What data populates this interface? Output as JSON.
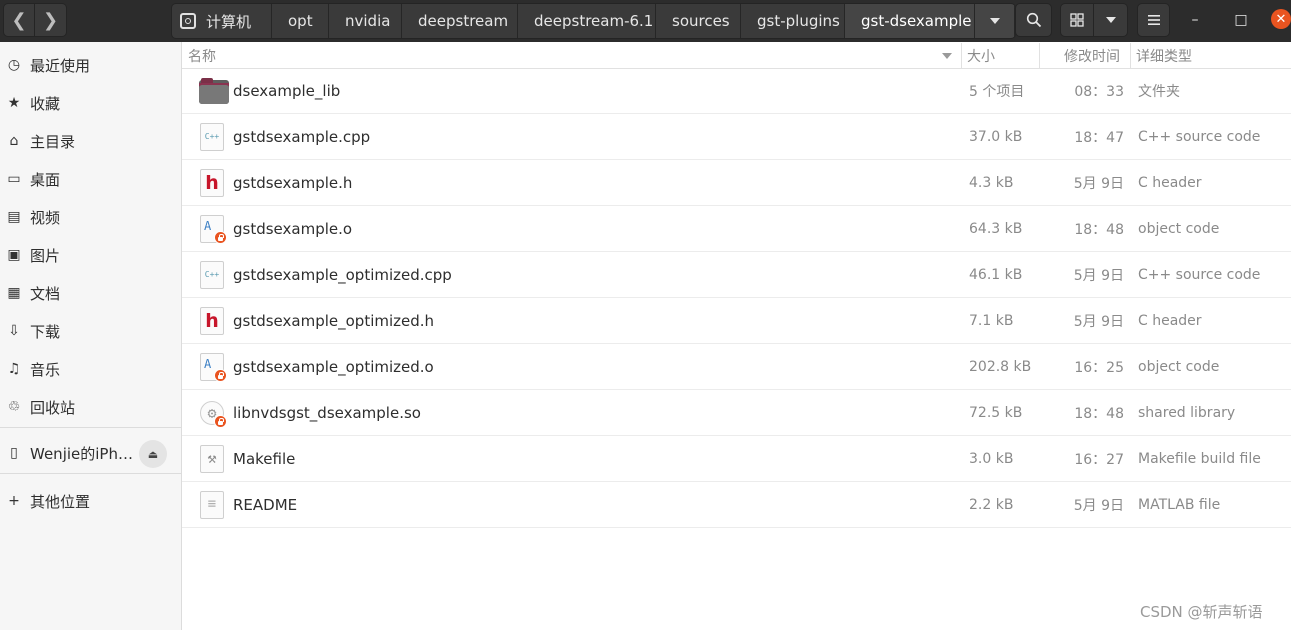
{
  "header": {
    "back_glyph": "❮",
    "forward_glyph": "❯",
    "breadcrumbs": [
      "计算机",
      "opt",
      "nvidia",
      "deepstream",
      "deepstream-6.1",
      "sources",
      "gst-plugins",
      "gst-dsexample"
    ],
    "window_controls": {
      "minimize": "–",
      "maximize": "□",
      "close": "✕"
    }
  },
  "sidebar": {
    "items": [
      {
        "label": "最近使用",
        "icon": "clock-icon",
        "glyph": "◷"
      },
      {
        "label": "收藏",
        "icon": "star-icon",
        "glyph": "★"
      },
      {
        "label": "主目录",
        "icon": "home-icon",
        "glyph": "⌂"
      },
      {
        "label": "桌面",
        "icon": "desktop-icon",
        "glyph": "▭"
      },
      {
        "label": "视频",
        "icon": "video-icon",
        "glyph": "▤"
      },
      {
        "label": "图片",
        "icon": "image-icon",
        "glyph": "▣"
      },
      {
        "label": "文档",
        "icon": "document-icon",
        "glyph": "▦"
      },
      {
        "label": "下载",
        "icon": "download-icon",
        "glyph": "⇩"
      },
      {
        "label": "音乐",
        "icon": "music-icon",
        "glyph": "♫"
      },
      {
        "label": "回收站",
        "icon": "trash-icon",
        "glyph": "♲"
      }
    ],
    "device": {
      "label": "Wenjie的iPh…",
      "icon": "phone-icon",
      "glyph": "▯",
      "eject_glyph": "⏏"
    },
    "other_locations": {
      "label": "其他位置",
      "glyph": "+"
    }
  },
  "columns": {
    "name": "名称",
    "size": "大小",
    "modified": "修改时间",
    "type": "详细类型"
  },
  "files": [
    {
      "name": "dsexample_lib",
      "size": "5 个项目",
      "modified": "08：33",
      "type": "文件夹",
      "icon": "folder-icon"
    },
    {
      "name": "gstdsexample.cpp",
      "size": "37.0 kB",
      "modified": "18：47",
      "type": "C++ source code",
      "icon": "cpp-file-icon",
      "badge": "C++"
    },
    {
      "name": "gstdsexample.h",
      "size": "4.3 kB",
      "modified": "5月 9日",
      "type": "C header",
      "icon": "header-file-icon",
      "badge": "h"
    },
    {
      "name": "gstdsexample.o",
      "size": "64.3 kB",
      "modified": "18：48",
      "type": "object code",
      "icon": "object-file-icon",
      "badge": "A"
    },
    {
      "name": "gstdsexample_optimized.cpp",
      "size": "46.1 kB",
      "modified": "5月 9日",
      "type": "C++ source code",
      "icon": "cpp-file-icon",
      "badge": "C++"
    },
    {
      "name": "gstdsexample_optimized.h",
      "size": "7.1 kB",
      "modified": "5月 9日",
      "type": "C header",
      "icon": "header-file-icon",
      "badge": "h"
    },
    {
      "name": "gstdsexample_optimized.o",
      "size": "202.8 kB",
      "modified": "16：25",
      "type": "object code",
      "icon": "object-file-icon",
      "badge": "A"
    },
    {
      "name": "libnvdsgst_dsexample.so",
      "size": "72.5 kB",
      "modified": "18：48",
      "type": "shared library",
      "icon": "shared-library-icon",
      "badge": "⚙"
    },
    {
      "name": "Makefile",
      "size": "3.0 kB",
      "modified": "16：27",
      "type": "Makefile build file",
      "icon": "makefile-icon",
      "badge": "⚒"
    },
    {
      "name": "README",
      "size": "2.2 kB",
      "modified": "5月 9日",
      "type": "MATLAB file",
      "icon": "text-file-icon",
      "badge": "≡"
    }
  ],
  "watermark": "CSDN @斩声斩语",
  "colors": {
    "headerbar": "#2c2c2c",
    "accent": "#e95420",
    "header_red": "#c7162b",
    "folder_tab": "#7b3048"
  }
}
